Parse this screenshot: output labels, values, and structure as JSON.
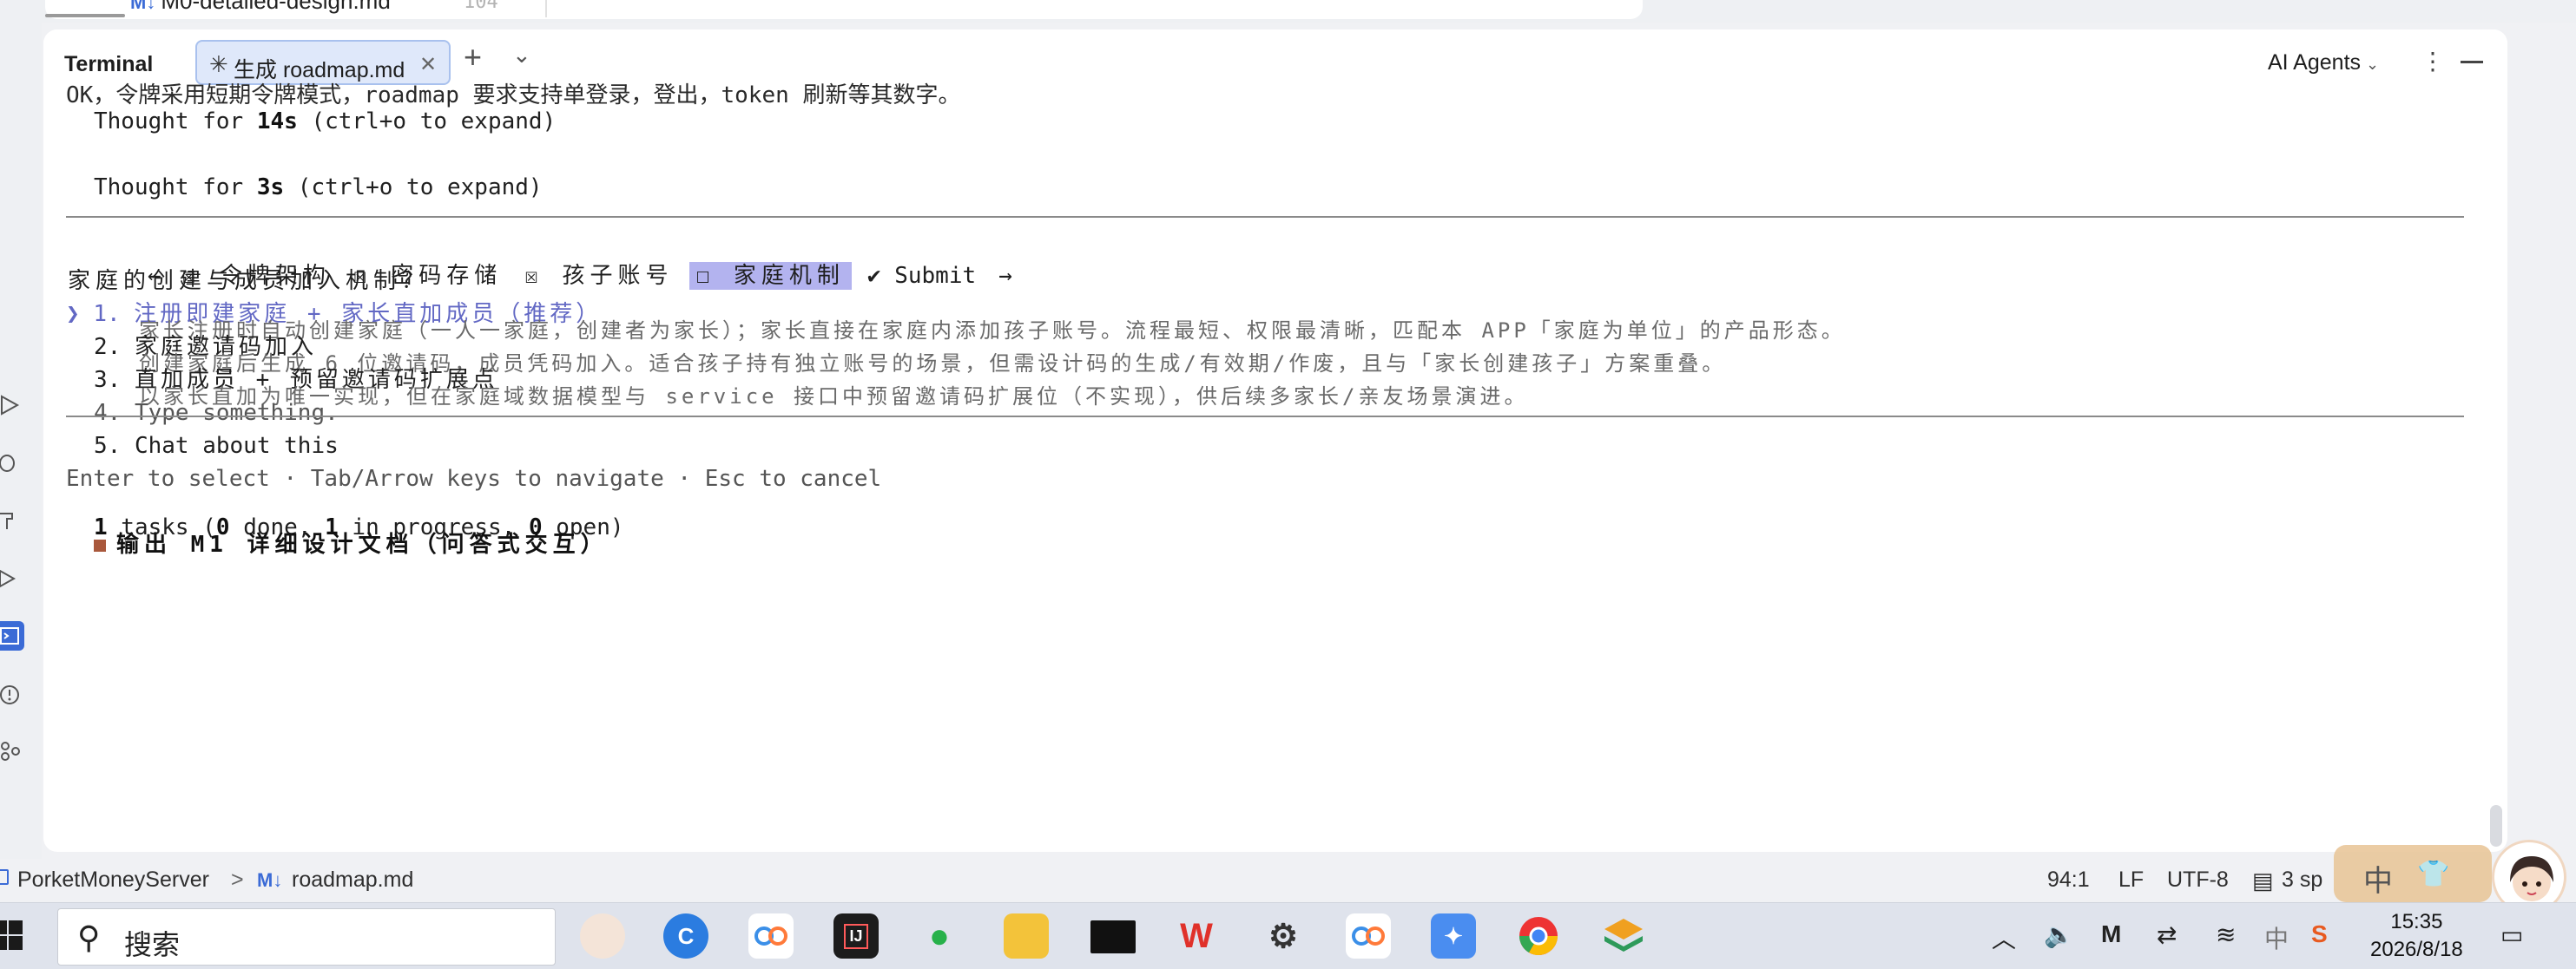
{
  "top_file_tab": {
    "label": "M0-detailed-design.md",
    "icon": "markdown-icon",
    "line_number": "104"
  },
  "terminal": {
    "title": "Terminal",
    "tab": {
      "label": "生成 roadmap.md",
      "icon": "asterisk-icon"
    },
    "agents_label": "AI Agents"
  },
  "output": {
    "cut_line": "OK，令牌采用短期令牌模式，roadmap 要求支持单登录，登出，token 刷新等其数字。",
    "thought1": {
      "prefix": "Thought for ",
      "time": "14s",
      "suffix": " (ctrl+o to expand)"
    },
    "thought2": {
      "prefix": "Thought for ",
      "time": "3s",
      "suffix": " (ctrl+o to expand)"
    },
    "nav": {
      "back": "←",
      "items": [
        {
          "mark": "☒",
          "label": "令牌架构"
        },
        {
          "mark": "☒",
          "label": "密码存储"
        },
        {
          "mark": "☒",
          "label": "孩子账号"
        }
      ],
      "active": {
        "mark": "☐",
        "label": "家庭机制"
      },
      "submit_mark": "✔",
      "submit": "Submit",
      "forward": "→"
    },
    "question": "家庭的创建与成员加入机制？",
    "pointer": "❯",
    "options": [
      {
        "num": "1.",
        "title": "注册即建家庭 + 家长直加成员（推荐）",
        "desc": "家长注册时自动创建家庭（一人一家庭，创建者为家长）；家长直接在家庭内添加孩子账号。流程最短、权限最清晰，匹配本 APP「家庭为单位」的产品形态。"
      },
      {
        "num": "2.",
        "title": "家庭邀请码加入",
        "desc": "创建家庭后生成 6 位邀请码，成员凭码加入。适合孩子持有独立账号的场景，但需设计码的生成/有效期/作废，且与「家长创建孩子」方案重叠。"
      },
      {
        "num": "3.",
        "title": "直加成员 + 预留邀请码扩展点",
        "desc": "以家长直加为唯一实现，但在家庭域数据模型与 service 接口中预留邀请码扩展位（不实现），供后续多家长/亲友场景演进。"
      },
      {
        "num": "4.",
        "title": "Type something."
      }
    ],
    "chat_option": "5. Chat about this",
    "hint": "Enter to select · Tab/Arrow keys to navigate · Esc to cancel",
    "tasks": {
      "count": "1",
      "summary": " tasks (",
      "done": "0",
      "done_label": " done, ",
      "inprog": "1",
      "inprog_label": " in progress, ",
      "open": "0",
      "open_label": " open)"
    },
    "task_item": "输出 M1 详细设计文档（问答式交互）"
  },
  "statusbar": {
    "project": "PorketMoneyServer",
    "separator": ">",
    "file": "roadmap.md",
    "position": "94:1",
    "line_ending": "LF",
    "encoding": "UTF-8",
    "indent": "3 sp"
  },
  "taskbar": {
    "search_placeholder": "搜索",
    "time": "15:35",
    "date": "2026/8/18",
    "ime": "中"
  },
  "colors": {
    "accent": "#3b6bd6",
    "active_nav_bg": "#b3b3ef",
    "selected_option": "#6268c4",
    "task_marker": "#a9583c"
  }
}
